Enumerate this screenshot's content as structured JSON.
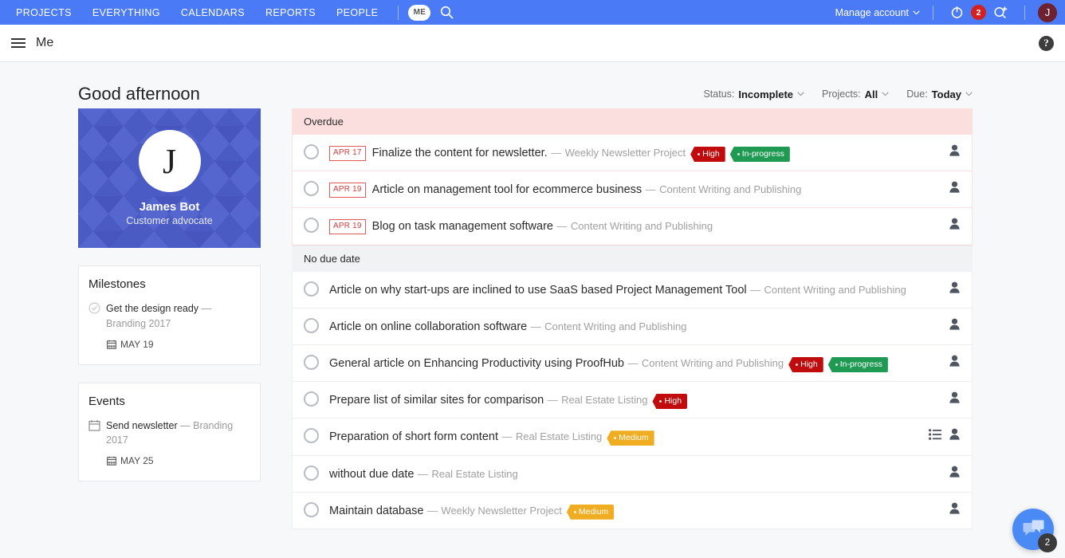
{
  "topnav": {
    "links": [
      "PROJECTS",
      "EVERYTHING",
      "CALENDARS",
      "REPORTS",
      "PEOPLE"
    ],
    "me_pill": "ME",
    "search_icon": "search-icon",
    "manage_account": "Manage account",
    "power_icon": "power-icon",
    "notification_count": "2",
    "add_user_icon": "add-user-icon",
    "avatar_initial": "J",
    "accent_color": "#4a7af5"
  },
  "subheader": {
    "menu_icon": "hamburger-icon",
    "title": "Me",
    "help_icon": "?"
  },
  "greeting": "Good afternoon",
  "filters": [
    {
      "label": "Status:",
      "value": "Incomplete"
    },
    {
      "label": "Projects:",
      "value": "All"
    },
    {
      "label": "Due:",
      "value": "Today"
    }
  ],
  "profile": {
    "initial": "J",
    "name": "James Bot",
    "role": "Customer advocate"
  },
  "milestones": {
    "title": "Milestones",
    "items": [
      {
        "name": "Get the design ready",
        "dash": "—",
        "project": "Branding 2017",
        "date": "MAY 19",
        "icon": "check-circle-icon"
      }
    ]
  },
  "events": {
    "title": "Events",
    "items": [
      {
        "name": "Send newsletter",
        "dash": "—",
        "project": "Branding 2017",
        "date": "MAY 25",
        "icon": "calendar-icon"
      }
    ]
  },
  "task_groups": [
    {
      "header": "Overdue",
      "style": "overdue",
      "tasks": [
        {
          "date_badge": "APR 17",
          "title": "Finalize the content for newsletter.",
          "dash": "—",
          "project": "Weekly Newsletter Project",
          "tags": [
            {
              "label": "High",
              "type": "high"
            },
            {
              "label": "In-progress",
              "type": "inprogress"
            }
          ],
          "actions": [
            "assignee-icon"
          ]
        },
        {
          "date_badge": "APR 19",
          "title": "Article on management tool for ecommerce business",
          "dash": "—",
          "project": "Content Writing and Publishing",
          "tags": [],
          "actions": [
            "assignee-icon"
          ]
        },
        {
          "date_badge": "APR 19",
          "title": "Blog on task management software",
          "dash": "—",
          "project": "Content Writing and Publishing",
          "tags": [],
          "actions": [
            "assignee-icon"
          ]
        }
      ]
    },
    {
      "header": "No due date",
      "style": "nodue",
      "tasks": [
        {
          "date_badge": "",
          "title": "Article on why start-ups are inclined to use SaaS based Project Management Tool",
          "dash": "—",
          "project": "Content Writing and Publishing",
          "tags": [],
          "actions": [
            "assignee-icon"
          ]
        },
        {
          "date_badge": "",
          "title": "Article on online collaboration software",
          "dash": "—",
          "project": "Content Writing and Publishing",
          "tags": [],
          "actions": [
            "assignee-icon"
          ]
        },
        {
          "date_badge": "",
          "title": "General article on Enhancing Productivity using ProofHub",
          "dash": "—",
          "project": "Content Writing and Publishing",
          "tags": [
            {
              "label": "High",
              "type": "high"
            },
            {
              "label": "In-progress",
              "type": "inprogress"
            }
          ],
          "actions": [
            "assignee-icon"
          ]
        },
        {
          "date_badge": "",
          "title": "Prepare list of similar sites for comparison",
          "dash": "—",
          "project": "Real Estate Listing",
          "tags": [
            {
              "label": "High",
              "type": "high"
            }
          ],
          "actions": [
            "assignee-icon"
          ]
        },
        {
          "date_badge": "",
          "title": "Preparation of short form content",
          "dash": "—",
          "project": "Real Estate Listing",
          "tags": [
            {
              "label": "Medium",
              "type": "medium"
            }
          ],
          "actions": [
            "subtask-list-icon",
            "assignee-icon"
          ]
        },
        {
          "date_badge": "",
          "title": "without due date",
          "dash": "—",
          "project": "Real Estate Listing",
          "tags": [],
          "actions": [
            "assignee-icon"
          ]
        },
        {
          "date_badge": "",
          "title": "Maintain database",
          "dash": "—",
          "project": "Weekly Newsletter Project",
          "tags": [
            {
              "label": "Medium",
              "type": "medium"
            }
          ],
          "actions": [
            "assignee-icon"
          ]
        }
      ]
    }
  ],
  "chat": {
    "icon": "chat-bubbles-icon",
    "unread": "2"
  }
}
